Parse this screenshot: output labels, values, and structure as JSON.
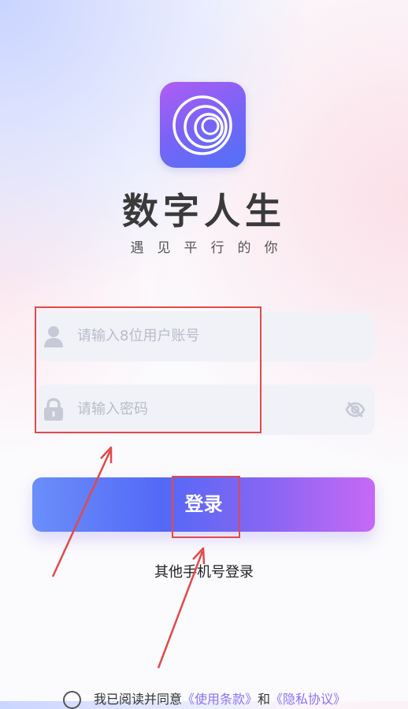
{
  "app": {
    "name": "数字人生",
    "slogan": "遇见平行的你"
  },
  "form": {
    "account_placeholder": "请输入8位用户账号",
    "password_placeholder": "请输入密码"
  },
  "buttons": {
    "login_label": "登录",
    "other_login_label": "其他手机号登录"
  },
  "agreement": {
    "prefix": "我已阅读并同意",
    "terms_link": "《使用条款》",
    "conjunction": "和",
    "privacy_link": "《隐私协议》"
  },
  "colors": {
    "accent": "#5468f6",
    "accent_end": "#c769f5",
    "annotation": "#e04a4a",
    "link": "#8a74f2"
  },
  "icons": {
    "logo": "concentric-rings-logo",
    "account": "user-icon",
    "password": "lock-icon",
    "toggle": "eye-off-icon"
  }
}
